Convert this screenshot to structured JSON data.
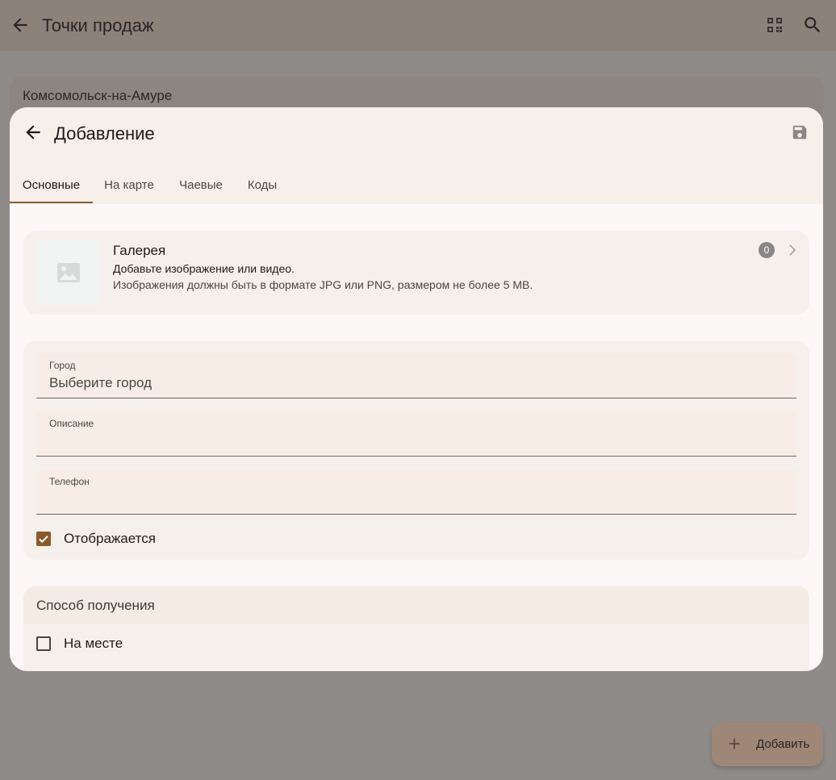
{
  "background": {
    "title": "Точки продаж",
    "card_title": "Комсомольск-на-Амуре",
    "fab_label": "Добавить",
    "icons": [
      "back-arrow-icon",
      "qr-code-icon",
      "search-icon",
      "plus-icon"
    ]
  },
  "dialog": {
    "title": "Добавление",
    "icons": [
      "back-arrow-icon",
      "save-icon"
    ],
    "tabs": [
      {
        "label": "Основные",
        "active": true
      },
      {
        "label": "На карте",
        "active": false
      },
      {
        "label": "Чаевые",
        "active": false
      },
      {
        "label": "Коды",
        "active": false
      }
    ],
    "gallery": {
      "title": "Галерея",
      "subtitle": "Добавьте изображение или видео.",
      "hint": "Изображения должны быть в формате JPG или PNG, размером не более 5 MB.",
      "count": "0"
    },
    "fields": [
      {
        "label": "Город",
        "value": "Выберите город"
      },
      {
        "label": "Описание",
        "value": ""
      },
      {
        "label": "Телефон",
        "value": ""
      }
    ],
    "visible_checkbox": {
      "label": "Отображается",
      "checked": true
    },
    "delivery": {
      "title": "Способ получения",
      "options": [
        {
          "label": "На месте",
          "checked": false
        }
      ]
    }
  },
  "colors": {
    "accent": "#8a5a2b",
    "scrim": "#8f8b89",
    "dialog_bg": "#fdf8f8",
    "card_bg": "#f6f0ec",
    "field_bg": "#f7ede6"
  }
}
